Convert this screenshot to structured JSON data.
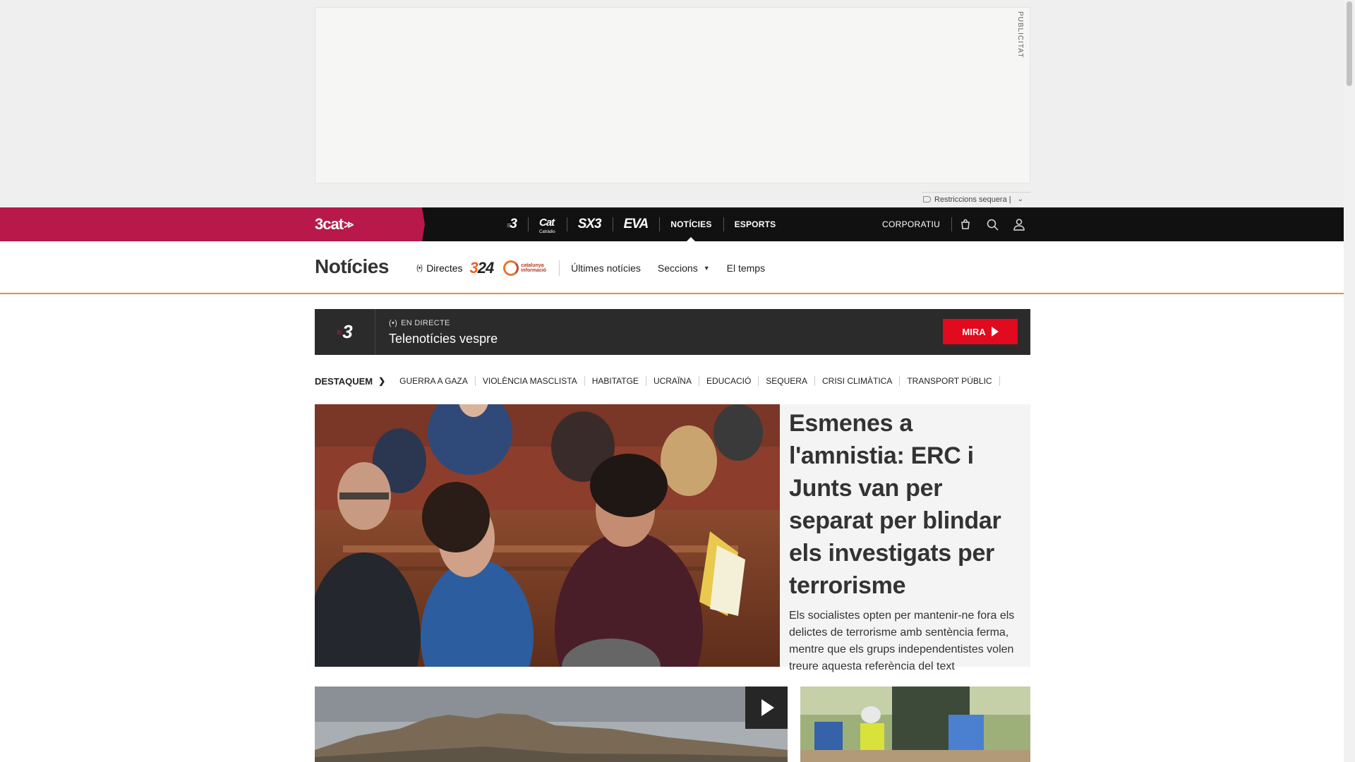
{
  "ad": {
    "label": "PUBLICITAT",
    "alert_text": "Restriccions sequera |"
  },
  "topbar": {
    "brand": "3cat",
    "channels": [
      {
        "icon": "tv3-logo",
        "text": "3"
      },
      {
        "icon": "catradio-logo",
        "text": "Cat",
        "sub": "Catràdio"
      },
      {
        "icon": "sx3-logo",
        "text": "SX3"
      },
      {
        "icon": "eva-logo",
        "text": "EVA"
      }
    ],
    "nav": {
      "noticies": "NOTÍCIES",
      "esports": "ESPORTS"
    },
    "corporatiu": "CORPORATIU",
    "icons": [
      "shop-bag-icon",
      "search-icon",
      "user-icon"
    ]
  },
  "section": {
    "title": "Notícies",
    "directes": "Directes",
    "channel_324": "3/24",
    "channel_ci_line1": "catalunya",
    "channel_ci_line2": "informació",
    "links": {
      "ultimes": "Últimes notícies",
      "seccions": "Seccions",
      "temps": "El temps"
    }
  },
  "live": {
    "channel": "3",
    "tag": "EN DIRECTE",
    "title": "Telenotícies vespre",
    "button": "MIRA"
  },
  "destaquem": {
    "label": "DESTAQUEM",
    "topics": [
      "GUERRA A GAZA",
      "VIOLÈNCIA MASCLISTA",
      "HABITATGE",
      "UCRAÏNA",
      "EDUCACIÓ",
      "SEQUERA",
      "CRISI CLIMÀTICA",
      "TRANSPORT PÚBLIC"
    ]
  },
  "main_story": {
    "headline": "Esmenes a l'amnistia: ERC i Junts van per separat per blindar els investigats per terrorisme",
    "lede": "Els socialistes opten per mantenir-ne fora els delictes de terrorisme amb sentència ferma, mentre que els grups independentistes volen treure aquesta referència del text"
  },
  "colors": {
    "brand": "#b8194a",
    "accent_orange": "#f08a3c",
    "live_red": "#e10a1e",
    "topbar": "#111111"
  }
}
